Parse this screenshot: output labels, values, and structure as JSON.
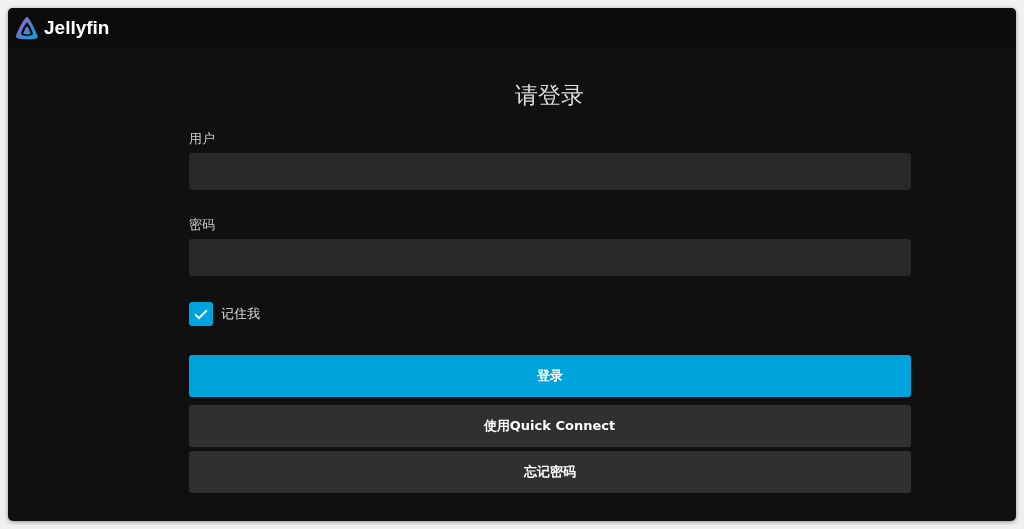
{
  "header": {
    "brand": "Jellyfin"
  },
  "form": {
    "title": "请登录",
    "fields": [
      {
        "label": "用户"
      },
      {
        "label": "密码"
      }
    ],
    "remember": {
      "label": "记住我",
      "checked": true
    },
    "buttons": [
      {
        "label": "登录",
        "kind": "primary"
      },
      {
        "label": "使用Quick Connect",
        "kind": "secondary"
      },
      {
        "label": "忘记密码",
        "kind": "secondary"
      }
    ]
  }
}
